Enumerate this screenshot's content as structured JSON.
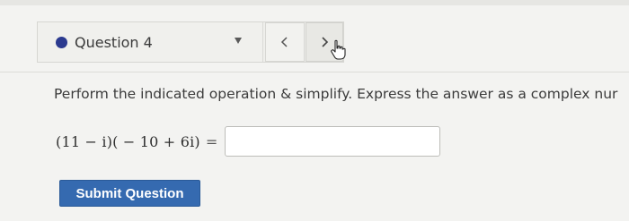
{
  "navigation": {
    "question_label": "Question 4",
    "prev_label": "<",
    "next_label": ">"
  },
  "question": {
    "instruction": "Perform the indicated operation & simplify. Express the answer as a complex nur",
    "expression": "(11 − i)( − 10 + 6i)",
    "equals": "=",
    "answer_value": ""
  },
  "actions": {
    "submit_label": "Submit Question"
  },
  "colors": {
    "status_dot": "#2b3a8f",
    "submit_bg": "#356ab0"
  }
}
